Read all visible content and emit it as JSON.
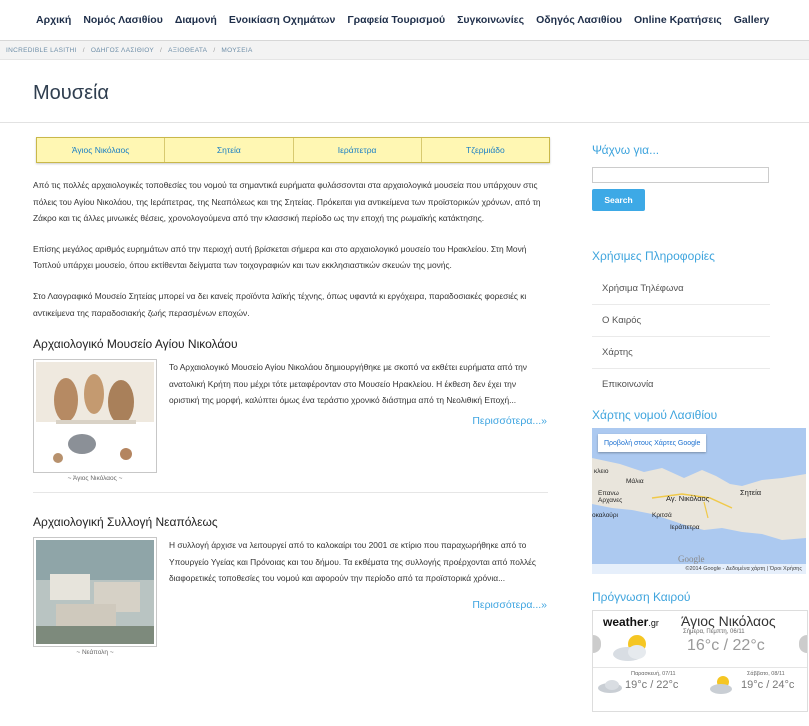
{
  "nav": {
    "items": [
      "Αρχική",
      "Νομός Λασιθίου",
      "Διαμονή",
      "Ενοικίαση Οχημάτων",
      "Γραφεία Τουρισμού",
      "Συγκοινωνίες",
      "Οδηγός Λασιθίου",
      "Online Κρατήσεις",
      "Gallery"
    ]
  },
  "breadcrumb": [
    "INCREDIBLE LASITHI",
    "ΟΔΗΓΟΣ ΛΑΣΙΘΙΟΥ",
    "ΑΞΙΟΘΕΑΤΑ",
    "ΜΟΥΣΕΙΑ"
  ],
  "page_title": "Μουσεία",
  "tabs": [
    "Άγιος Νικόλαος",
    "Σητεία",
    "Ιεράπετρα",
    "Τζερμιάδο"
  ],
  "paragraphs": [
    "Από τις πολλές αρχαιολογικές τοποθεσίες του νομού τα σημαντικά ευρήματα φυλάσσονται στα αρχαιολογικά μουσεία που υπάρχουν στις πόλεις του Αγίου Νικολάου, της Ιεράπετρας, της Νεαπόλεως και της Σητείας. Πρόκειται για αντικείμενα των προϊστορικών χρόνων, από τη Ζάκρο και τις άλλες μινωικές θέσεις, χρονολογούμενα από την κλασσική περίοδο ως την εποχή της ρωμαϊκής κατάκτησης.",
    "Επίσης μεγάλος αριθμός ευρημάτων από την περιοχή αυτή βρίσκεται σήμερα και στο αρχαιολογικό μουσείο του Ηρακλείου. Στη Μονή Τοπλού υπάρχει μουσείο, όπου εκτίθενται δείγματα των τοιχογραφιών και των εκκλησιαστικών σκευών της μονής.",
    "Στο Λαογραφικό Μουσείο Σητείας μπορεί να δει κανείς προϊόντα λαϊκής τέχνης, όπως υφαντά κι εργόχειρα, παραδοσιακές φορεσιές κι αντικείμενα της παραδοσιακής ζωής περασμένων εποχών."
  ],
  "museums": [
    {
      "title": "Αρχαιολογικό Μουσείο Αγίου Νικολάου",
      "caption": "~ Άγιος Νικόλαος ~",
      "text": "Το Αρχαιολογικό Μουσείο Αγίου Νικολάου δημιουργήθηκε με σκοπό να εκθέτει ευρήματα από την ανατολική Κρήτη που μέχρι τότε μεταφέρονταν στο Μουσείο Ηρακλείου. Η έκθεση δεν έχει την οριστική της μορφή, καλύπτει όμως ένα τεράστιο χρονικό διάστημα από τη Νεολιθική Εποχή...",
      "more": "Περισσότερα...»"
    },
    {
      "title": "Αρχαιολογική Συλλογή Νεαπόλεως",
      "caption": "~ Νεάπολη ~",
      "text": "Η συλλογή άρχισε να λειτουργεί από το καλοκαίρι του 2001 σε κτίριο που παραχωρήθηκε από το Υπουργείο Υγείας και Πρόνοιας και του δήμου. Τα εκθέματα της συλλογής προέρχονται από πολλές διαφορετικές τοποθεσίες του νομού και αφορούν την περίοδο από τα προϊστορικά χρόνια...",
      "more": "Περισσότερα...»"
    }
  ],
  "sidebar": {
    "search_title": "Ψάχνω για...",
    "search_button": "Search",
    "info_title": "Χρήσιμες Πληροφορίες",
    "info_items": [
      "Χρήσιμα Τηλέφωνα",
      "Ο Καιρός",
      "Χάρτης",
      "Επικοινωνία"
    ],
    "map_title": "Χάρτης νομού Λασιθίου",
    "map_button": "Προβολή στους Χάρτες Google",
    "map_labels": [
      "κλειο",
      "Μάλια",
      "Επανω Αρχανες",
      "Αγ. Νικόλαος",
      "Σητεία",
      "οκαλούρι",
      "Κριτσά",
      "Ιεράπετρα"
    ],
    "map_logo": "Google",
    "map_footer": "©2014 Google - Δεδομένα χάρτη | Όροι Χρήσης",
    "weather_title": "Πρόγνωση Καιρού",
    "weather": {
      "brand": "weather",
      "brand_suffix": ".gr",
      "city": "Άγιος Νικόλαος",
      "today_label": "Σήμερα, Πέμπτη, 06/11",
      "today_temp": "16°c / 22°c",
      "fc1_label": "Παρασκευή, 07/11",
      "fc1_temp": "19°c / 22°c",
      "fc2_label": "Σάββατο, 08/11",
      "fc2_temp": "19°c / 24°c"
    }
  },
  "colors": {
    "link": "#3da4e0",
    "tab_bg": "#fff7b3",
    "button": "#3da9e6"
  }
}
